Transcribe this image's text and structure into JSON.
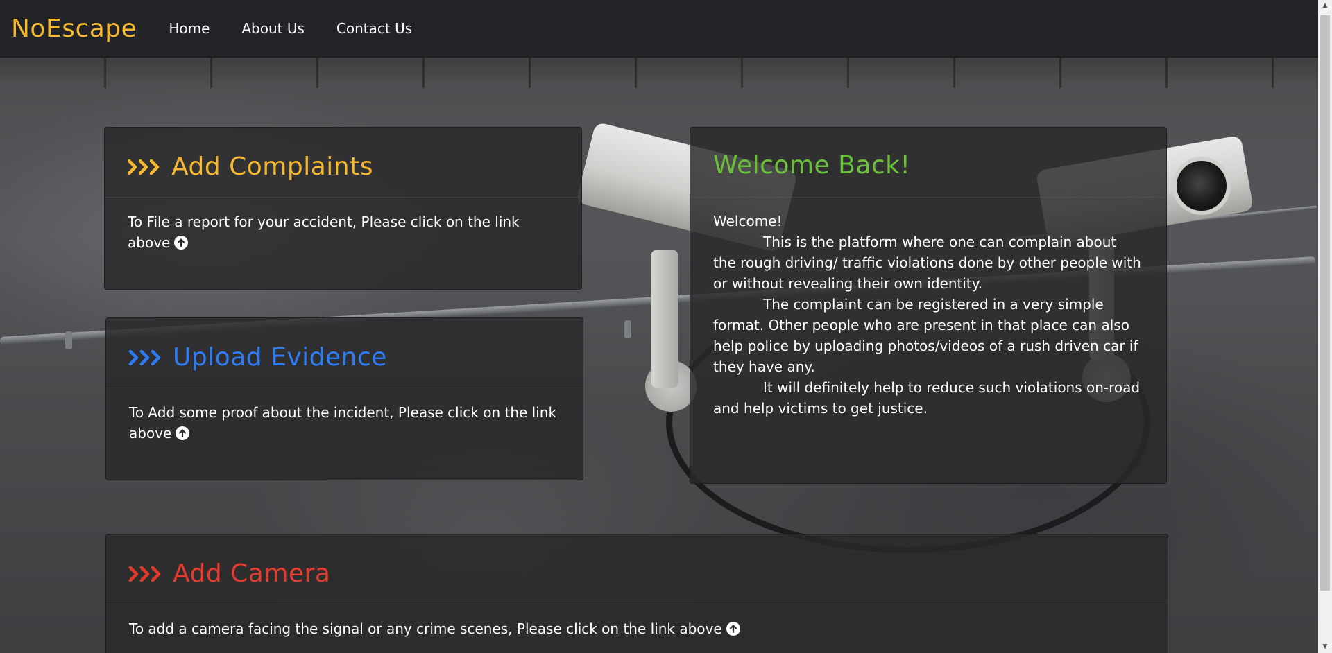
{
  "nav": {
    "brand": "NoEscape",
    "links": [
      "Home",
      "About Us",
      "Contact Us"
    ]
  },
  "cards": {
    "complaints": {
      "title": "Add Complaints",
      "text": "To File a report for your accident, Please click on the link above",
      "color": "#f5b82e"
    },
    "evidence": {
      "title": "Upload Evidence",
      "text": "To Add some proof about the incident, Please click on the link above",
      "color": "#2f7cf2"
    },
    "camera": {
      "title": "Add Camera",
      "text": "To add a camera facing the signal or any crime scenes, Please click on the link above",
      "color": "#e53b2f"
    }
  },
  "welcome": {
    "title": "Welcome Back!",
    "greeting": "Welcome!",
    "paragraphs": [
      "This is the platform where one can complain about the rough driving/ traffic violations done by other people with or without revealing their own identity.",
      "The complaint can be registered in a very simple format. Other people who are present in that place can also help police by uploading photos/videos of a rush driven car if they have any.",
      "It will definitely help to reduce such violations on-road and help victims to get justice."
    ],
    "color": "#6ac03a"
  },
  "icons": {
    "chevrons": "triple-chevron-right-icon",
    "up_arrow": "arrow-up-circle-icon"
  }
}
